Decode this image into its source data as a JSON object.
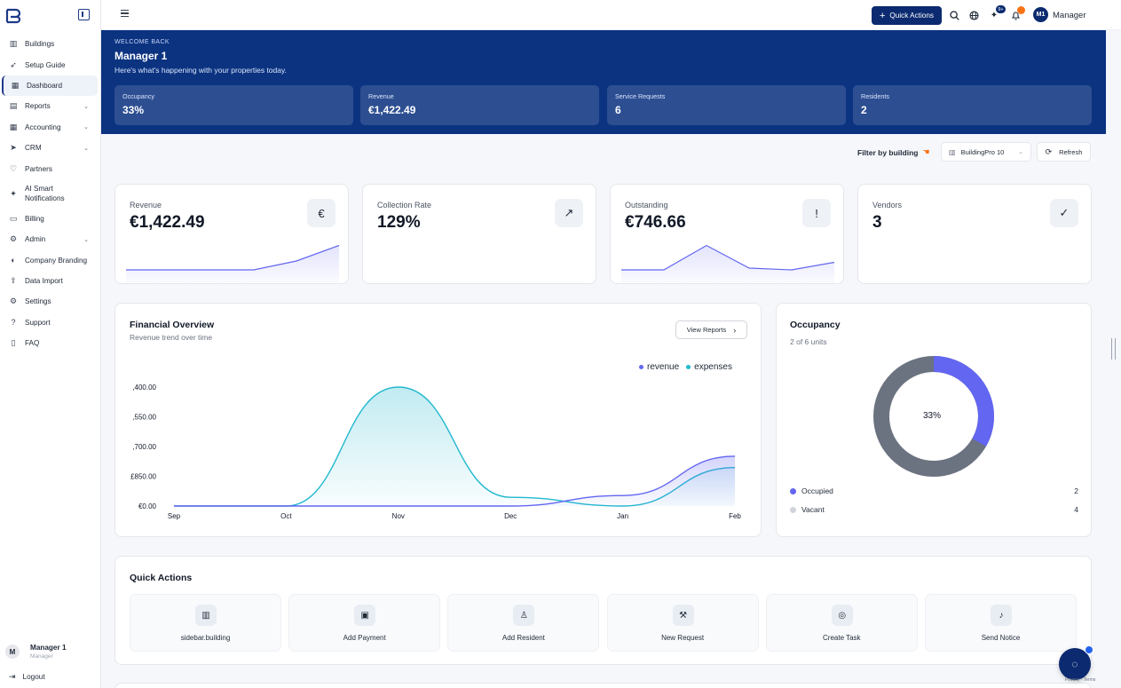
{
  "sidebar": {
    "items": [
      {
        "label": "Buildings",
        "icon": "building-icon"
      },
      {
        "label": "Setup Guide",
        "icon": "rocket-icon"
      },
      {
        "label": "Dashboard",
        "icon": "grid-icon",
        "active": true
      },
      {
        "label": "Reports",
        "icon": "document-icon",
        "expandable": true
      },
      {
        "label": "Accounting",
        "icon": "calculator-icon",
        "expandable": true
      },
      {
        "label": "CRM",
        "icon": "send-icon",
        "expandable": true
      },
      {
        "label": "Partners",
        "icon": "handshake-icon"
      },
      {
        "label": "AI Smart Notifications",
        "label_line1": "AI Smart",
        "label_line2": "Notifications",
        "icon": "sparkle-icon"
      },
      {
        "label": "Billing",
        "icon": "credit-card-icon"
      },
      {
        "label": "Admin",
        "icon": "gear-icon",
        "expandable": true
      },
      {
        "label": "Company Branding",
        "icon": "palette-icon"
      },
      {
        "label": "Data Import",
        "icon": "upload-icon"
      },
      {
        "label": "Settings",
        "icon": "settings-icon"
      },
      {
        "label": "Support",
        "icon": "help-icon"
      },
      {
        "label": "FAQ",
        "icon": "book-icon"
      }
    ],
    "user": {
      "initial": "M",
      "name": "Manager 1",
      "role": "Manager"
    },
    "logout_label": "Logout"
  },
  "topbar": {
    "quick_actions_label": "Quick Actions",
    "notification_badge": "9+",
    "avatar_initials": "M1",
    "username": "Manager"
  },
  "hero": {
    "eyebrow": "WELCOME BACK",
    "title": "Manager 1",
    "subtitle": "Here's what's happening with your properties today.",
    "stats": [
      {
        "label": "Occupancy",
        "value": "33%"
      },
      {
        "label": "Revenue",
        "value": "€1,422.49"
      },
      {
        "label": "Service Requests",
        "value": "6"
      },
      {
        "label": "Residents",
        "value": "2"
      }
    ]
  },
  "filter": {
    "label": "Filter by building",
    "building": "BuildingPro 10",
    "refresh_label": "Refresh"
  },
  "kpis": [
    {
      "label": "Revenue",
      "value": "€1,422.49",
      "icon": "euro-icon",
      "glyph": "€",
      "spark": [
        0,
        0,
        0,
        0,
        0.2,
        0.55
      ]
    },
    {
      "label": "Collection Rate",
      "value": "129%",
      "icon": "trend-up-icon",
      "glyph": "↗",
      "spark": null
    },
    {
      "label": "Outstanding",
      "value": "€746.66",
      "icon": "alert-circle-icon",
      "glyph": "!",
      "spark": [
        0,
        0,
        0.55,
        0.04,
        0,
        0.17
      ]
    },
    {
      "label": "Vendors",
      "value": "3",
      "icon": "user-check-icon",
      "glyph": "✓",
      "spark": null
    }
  ],
  "financial": {
    "title": "Financial Overview",
    "subtitle": "Revenue trend over time",
    "view_reports_label": "View Reports",
    "chart_data": {
      "type": "area",
      "categories": [
        "Sep",
        "Oct",
        "Nov",
        "Dec",
        "Jan",
        "Feb"
      ],
      "yticks": [
        ",400.00",
        ",550.00",
        "',700.00",
        "£850.00",
        "€0.00"
      ],
      "ytick_labels": [
        ",400.00",
        ",550.00",
        ",700.00",
        "£850.00",
        "€0.00"
      ],
      "ylim": [
        0,
        3400
      ],
      "series": [
        {
          "name": "revenue",
          "color": "#6366f1",
          "values": [
            0,
            0,
            0,
            0,
            300,
            1422.49
          ]
        },
        {
          "name": "expenses",
          "color": "#22b8cf",
          "values": [
            0,
            0,
            3400,
            250,
            0,
            1100
          ]
        }
      ]
    }
  },
  "occupancy": {
    "title": "Occupancy",
    "subtitle": "2 of 6 units",
    "center_label": "33%",
    "occupied_fraction": 0.333,
    "colors": {
      "occupied": "#6366f1",
      "vacant": "#6b7280"
    },
    "legend": [
      {
        "label": "Occupied",
        "count": "2",
        "color": "#6366f1"
      },
      {
        "label": "Vacant",
        "count": "4",
        "color": "#d1d5db"
      }
    ]
  },
  "quick_actions": {
    "title": "Quick Actions",
    "items": [
      {
        "label": "sidebar.building",
        "icon": "building-icon",
        "glyph": "▥"
      },
      {
        "label": "Add Payment",
        "icon": "wallet-icon",
        "glyph": "▣"
      },
      {
        "label": "Add Resident",
        "icon": "user-plus-icon",
        "glyph": "♙"
      },
      {
        "label": "New Request",
        "icon": "wrench-icon",
        "glyph": "⚒"
      },
      {
        "label": "Create Task",
        "icon": "target-icon",
        "glyph": "◎"
      },
      {
        "label": "Send Notice",
        "icon": "bell-icon",
        "glyph": "♪"
      }
    ]
  },
  "recaptcha_text": "Privacy - Terms"
}
